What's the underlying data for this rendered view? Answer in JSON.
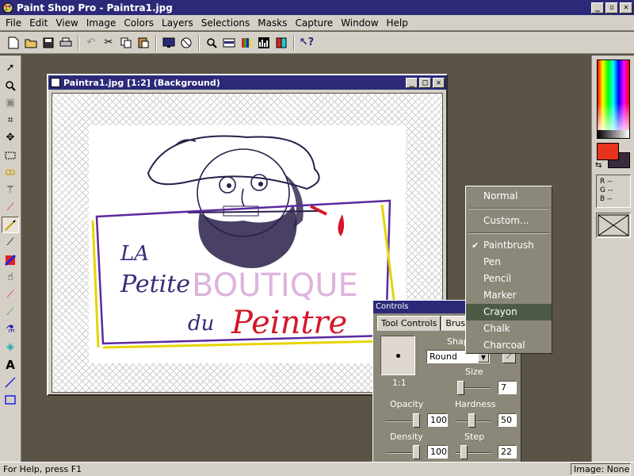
{
  "window": {
    "title": "Paint Shop Pro - Paintra1.jpg",
    "minimize": "_",
    "maximize": "▫",
    "close": "✕"
  },
  "menu": [
    "File",
    "Edit",
    "View",
    "Image",
    "Colors",
    "Layers",
    "Selections",
    "Masks",
    "Capture",
    "Window",
    "Help"
  ],
  "toolbar_icons": [
    "new-icon",
    "open-icon",
    "save-icon",
    "print-icon",
    "undo-icon",
    "cut-icon",
    "copy-icon",
    "paste-icon",
    "full-screen-icon",
    "normal-viewing-icon",
    "zoom-icon",
    "toggle-toolbar-icon",
    "toggle-palette-icon",
    "histogram-icon",
    "color-palette-icon",
    "help-pointer-icon"
  ],
  "tools": [
    "arrow-tool",
    "zoom-tool",
    "deformation-tool",
    "crop-tool",
    "mover-tool",
    "selection-tool",
    "freehand-tool",
    "magic-wand-tool",
    "dropper-tool",
    "paintbrush-tool",
    "clone-brush-tool",
    "color-replacer-tool",
    "retouch-tool",
    "eraser-tool",
    "picture-tube-tool",
    "airbrush-tool",
    "flood-fill-tool",
    "text-tool",
    "line-tool",
    "shapes-tool"
  ],
  "image_window": {
    "title": "Paintra1.jpg  [1:2]  (Background)"
  },
  "artwork": {
    "line1": "LA",
    "line2": "Petite",
    "line3": "BOUTIQUE",
    "line4": "du",
    "line5": "Peintre"
  },
  "color_panel": {
    "fg_color": "#e8331c",
    "bg_color": "#3a2a3e",
    "r": "R --",
    "g": "G --",
    "b": "B --"
  },
  "brush_menu": {
    "items": [
      {
        "label": "Normal",
        "checked": false,
        "selected": false
      },
      {
        "label": "Custom...",
        "checked": false,
        "selected": false
      },
      {
        "label": "Paintbrush",
        "checked": true,
        "selected": false
      },
      {
        "label": "Pen",
        "checked": false,
        "selected": false
      },
      {
        "label": "Pencil",
        "checked": false,
        "selected": false
      },
      {
        "label": "Marker",
        "checked": false,
        "selected": false
      },
      {
        "label": "Crayon",
        "checked": false,
        "selected": true
      },
      {
        "label": "Chalk",
        "checked": false,
        "selected": false
      },
      {
        "label": "Charcoal",
        "checked": false,
        "selected": false
      }
    ]
  },
  "controls": {
    "title": "Controls",
    "tab_tool": "Tool Controls",
    "tab_brush": "Brush",
    "ratio": "1:1",
    "shape_label": "Shap",
    "shape_value": "Round",
    "size_label": "Size",
    "size_value": "7",
    "opacity_label": "Opacity",
    "opacity_value": "100",
    "hardness_label": "Hardness",
    "hardness_value": "50",
    "density_label": "Density",
    "density_value": "100",
    "step_label": "Step",
    "step_value": "22"
  },
  "status": {
    "help": "For Help, press F1",
    "image": "Image: None"
  }
}
